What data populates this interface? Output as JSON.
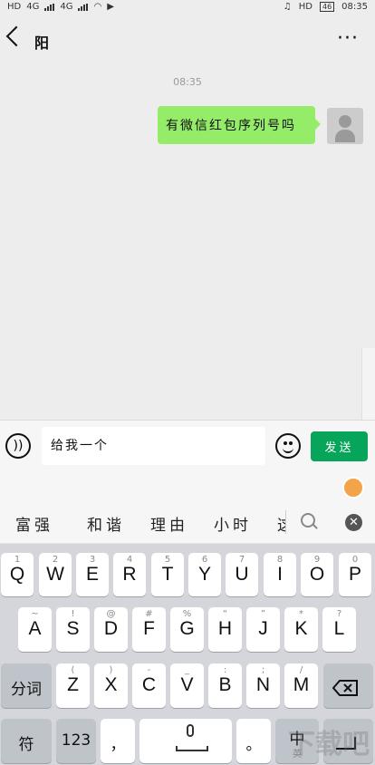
{
  "status_bar": {
    "left_labels": [
      "HD",
      "4G",
      "4G"
    ],
    "right_labels": [
      "HD"
    ],
    "battery": "46",
    "time": "08:35"
  },
  "header": {
    "title": "阳",
    "more": "···"
  },
  "chat": {
    "timestamp": "08:35",
    "messages": [
      {
        "text": "有微信红包序列号吗",
        "from": "me"
      }
    ]
  },
  "input_bar": {
    "value": "给我一个",
    "send_label": "发送",
    "voice_symbol": "))"
  },
  "candidates": [
    "富强",
    "和谐",
    "理由",
    "小时",
    "这"
  ],
  "close_symbol": "✕",
  "keyboard": {
    "row1": [
      {
        "main": "Q",
        "sub": "1"
      },
      {
        "main": "W",
        "sub": "2"
      },
      {
        "main": "E",
        "sub": "3"
      },
      {
        "main": "R",
        "sub": "4"
      },
      {
        "main": "T",
        "sub": "5"
      },
      {
        "main": "Y",
        "sub": "6"
      },
      {
        "main": "U",
        "sub": "7"
      },
      {
        "main": "I",
        "sub": "8"
      },
      {
        "main": "O",
        "sub": "9"
      },
      {
        "main": "P",
        "sub": "0"
      }
    ],
    "row2": [
      {
        "main": "A",
        "sub": "~"
      },
      {
        "main": "S",
        "sub": "!"
      },
      {
        "main": "D",
        "sub": "@"
      },
      {
        "main": "F",
        "sub": "#"
      },
      {
        "main": "G",
        "sub": "%"
      },
      {
        "main": "H",
        "sub": "“"
      },
      {
        "main": "J",
        "sub": "”"
      },
      {
        "main": "K",
        "sub": "*"
      },
      {
        "main": "L",
        "sub": "?"
      }
    ],
    "row3": [
      {
        "main": "Z",
        "sub": "("
      },
      {
        "main": "X",
        "sub": ")"
      },
      {
        "main": "C",
        "sub": "-"
      },
      {
        "main": "V",
        "sub": "_"
      },
      {
        "main": "B",
        "sub": ":"
      },
      {
        "main": "N",
        "sub": ";"
      },
      {
        "main": "M",
        "sub": "/"
      }
    ],
    "fenci_label": "分词",
    "fu_label": "符",
    "num_label": "123",
    "comma_label": "，",
    "period_label": "。",
    "zhong_label": "中",
    "zhong_sub": "英"
  },
  "watermark": "下载吧"
}
